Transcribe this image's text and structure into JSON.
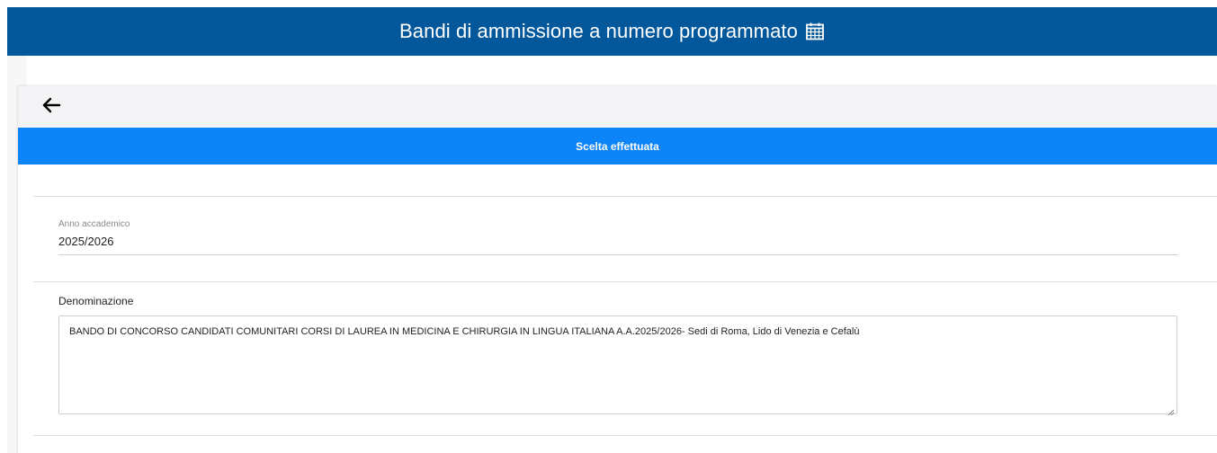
{
  "header": {
    "title": "Bandi di ammissione a numero programmato",
    "icon": "calendar-icon",
    "background_color": "#03579b"
  },
  "back_bar": {
    "icon": "arrow-left-icon"
  },
  "banner": {
    "label": "Scelta effettuata",
    "background_color": "#0d84f8"
  },
  "form": {
    "anno_accademico": {
      "label": "Anno accademico",
      "value": "2025/2026"
    },
    "denominazione": {
      "label": "Denominazione",
      "value": "BANDO DI CONCORSO CANDIDATI COMUNITARI CORSI DI LAUREA IN MEDICINA E CHIRURGIA IN LINGUA ITALIANA A.A.2025/2026- Sedi di Roma, Lido di Venezia e Cefalù"
    }
  }
}
